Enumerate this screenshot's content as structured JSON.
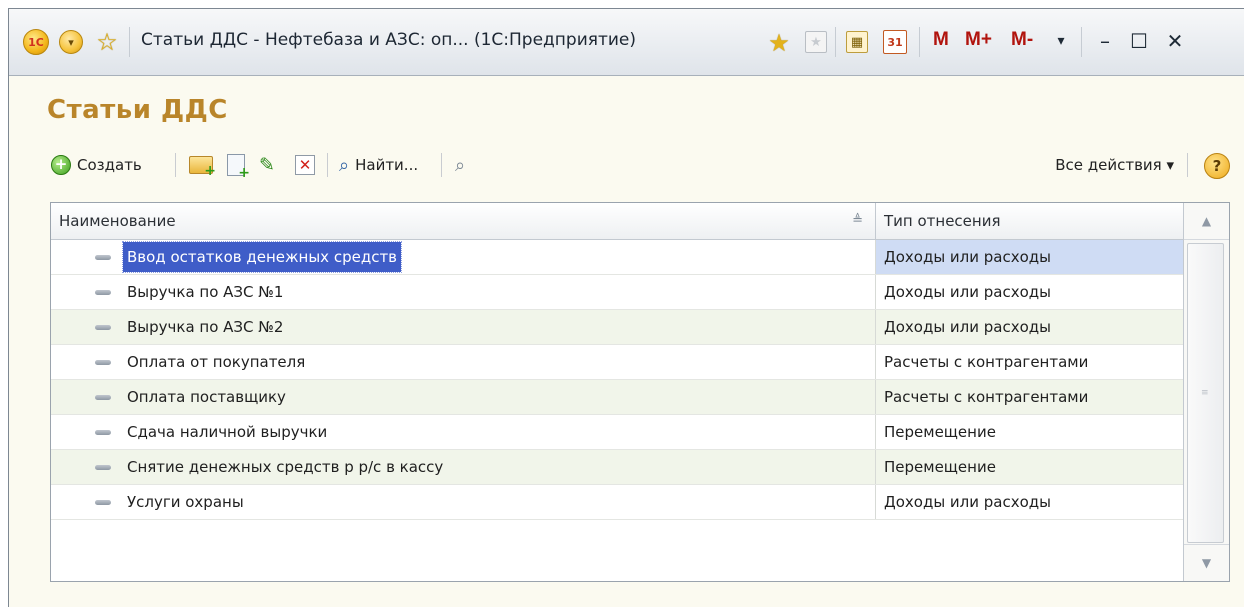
{
  "window": {
    "title": "Статьи ДДС - Нефтебаза и АЗС: оп... (1С:Предприятие)",
    "logo_text": "1С",
    "memory_buttons": [
      "M",
      "M+",
      "M-"
    ],
    "calendar_day": "31"
  },
  "page": {
    "title": "Статьи ДДС"
  },
  "toolbar": {
    "create_label": "Создать",
    "find_label": "Найти...",
    "all_actions_label": "Все действия ▾",
    "help_label": "?"
  },
  "table": {
    "columns": [
      "Наименование",
      "Тип отнесения"
    ],
    "rows": [
      {
        "name": "Ввод остатков денежных средств",
        "type": "Доходы или расходы",
        "selected": true
      },
      {
        "name": "Выручка по АЗС №1",
        "type": "Доходы или расходы"
      },
      {
        "name": "Выручка по АЗС №2",
        "type": "Доходы или расходы"
      },
      {
        "name": "Оплата от покупателя",
        "type": "Расчеты с контрагентами"
      },
      {
        "name": "Оплата поставщику",
        "type": "Расчеты с контрагентами"
      },
      {
        "name": "Сдача наличной выручки",
        "type": "Перемещение"
      },
      {
        "name": "Снятие денежных средств р р/с в кассу",
        "type": "Перемещение"
      },
      {
        "name": "Услуги охраны",
        "type": "Доходы или расходы"
      }
    ]
  },
  "colors": {
    "title_color": "#b9852a",
    "selection": "#3f5dc8",
    "alt_row": "#f1f5ea",
    "memory_red": "#b1140e"
  },
  "icons": [
    "1c-logo-icon",
    "main-menu-icon",
    "favorite-star-icon",
    "add-to-favorites-icon",
    "bookmark-icon",
    "calculator-icon",
    "calendar-icon",
    "create-folder-icon",
    "copy-icon",
    "edit-icon",
    "delete-mark-icon",
    "search-icon",
    "cancel-search-icon",
    "help-icon",
    "sort-icon",
    "element-icon"
  ]
}
